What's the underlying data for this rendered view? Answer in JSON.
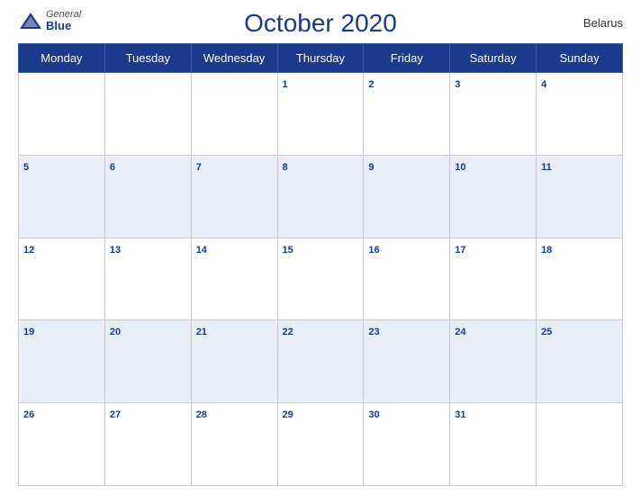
{
  "header": {
    "logo": {
      "general": "General",
      "blue": "Blue",
      "icon_shape": "triangle"
    },
    "title": "October 2020",
    "country": "Belarus"
  },
  "calendar": {
    "weekdays": [
      "Monday",
      "Tuesday",
      "Wednesday",
      "Thursday",
      "Friday",
      "Saturday",
      "Sunday"
    ],
    "weeks": [
      [
        null,
        null,
        null,
        1,
        2,
        3,
        4
      ],
      [
        5,
        6,
        7,
        8,
        9,
        10,
        11
      ],
      [
        12,
        13,
        14,
        15,
        16,
        17,
        18
      ],
      [
        19,
        20,
        21,
        22,
        23,
        24,
        25
      ],
      [
        26,
        27,
        28,
        29,
        30,
        31,
        null
      ]
    ]
  }
}
